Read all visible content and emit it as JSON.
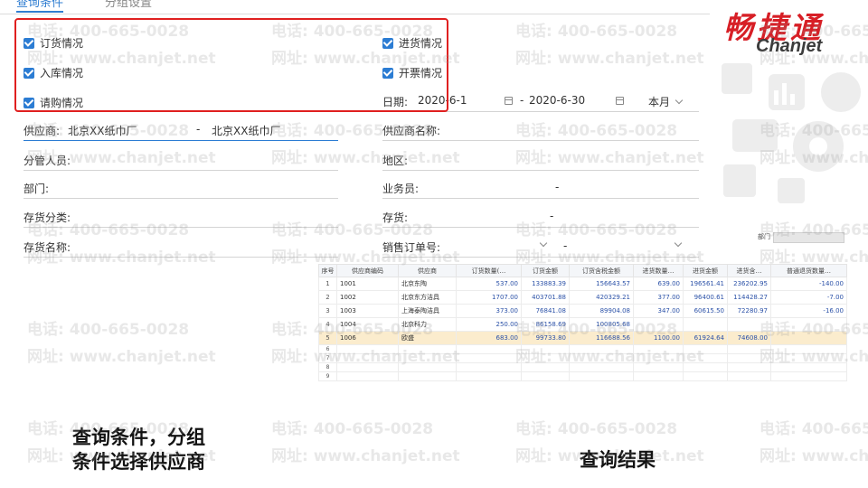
{
  "tabs": [
    "查询条件",
    "分组设置"
  ],
  "checkboxes": [
    {
      "label": "订货情况",
      "checked": true
    },
    {
      "label": "入库情况",
      "checked": true
    },
    {
      "label": "请购情况",
      "checked": true
    },
    {
      "label": "进货情况",
      "checked": true
    },
    {
      "label": "开票情况",
      "checked": true
    }
  ],
  "date": {
    "label": "日期:",
    "from": "2020-6-1",
    "sep": "-",
    "to": "2020-6-30",
    "period": "本月"
  },
  "fields": {
    "supplier": {
      "label": "供应商:",
      "from": "北京XX纸巾厂",
      "sep": "-",
      "to": "北京XX纸巾厂"
    },
    "supplier_name": {
      "label": "供应商名称:"
    },
    "manager": {
      "label": "分管人员:"
    },
    "region": {
      "label": "地区:"
    },
    "dept": {
      "label": "部门:"
    },
    "salesperson": {
      "label": "业务员:",
      "sep": "-"
    },
    "inv_class": {
      "label": "存货分类:"
    },
    "inventory": {
      "label": "存货:",
      "sep": "-"
    },
    "inv_name": {
      "label": "存货名称:"
    },
    "sales_order": {
      "label": "销售订单号:",
      "sep": "-"
    }
  },
  "logo": {
    "cn": "畅捷通",
    "en": "Chanjet"
  },
  "grid": {
    "dept_label": "部门",
    "headers": [
      "序号",
      "供应商编码",
      "供应商",
      "订货数量(…",
      "订货金额",
      "订货含税金额",
      "进货数量…",
      "进货金额",
      "进货含…",
      "普通退货数量…"
    ],
    "rows": [
      [
        "1",
        "1001",
        "北京东陶",
        "537.00",
        "133883.39",
        "156643.57",
        "639.00",
        "196561.41",
        "236202.95",
        "-140.00"
      ],
      [
        "2",
        "1002",
        "北京东方洁具",
        "1707.00",
        "403701.88",
        "420329.21",
        "377.00",
        "96400.61",
        "114428.27",
        "-7.00"
      ],
      [
        "3",
        "1003",
        "上海泰陶洁具",
        "373.00",
        "76841.08",
        "89904.08",
        "347.00",
        "60615.50",
        "72280.97",
        "-16.00"
      ],
      [
        "4",
        "1004",
        "北京科力",
        "250.00",
        "86158.69",
        "100805.68",
        "",
        "",
        "",
        ""
      ],
      [
        "5",
        "1006",
        "欧盛",
        "683.00",
        "99733.80",
        "116688.56",
        "1100.00",
        "61924.64",
        "74608.00",
        ""
      ]
    ],
    "empty_rows": [
      "6",
      "7",
      "8",
      "9"
    ]
  },
  "captions": {
    "left_line1": "查询条件，分组",
    "left_line2": "条件选择供应商",
    "right": "查询结果"
  },
  "watermark": {
    "phone": "电话: 400-665-0028",
    "site": "网址: www.chanjet.net"
  },
  "colors": {
    "accent": "#2b7cd3",
    "highlight_frame": "#e02020",
    "brand": "#d71f26",
    "row_highlight": "#fbeccd"
  }
}
